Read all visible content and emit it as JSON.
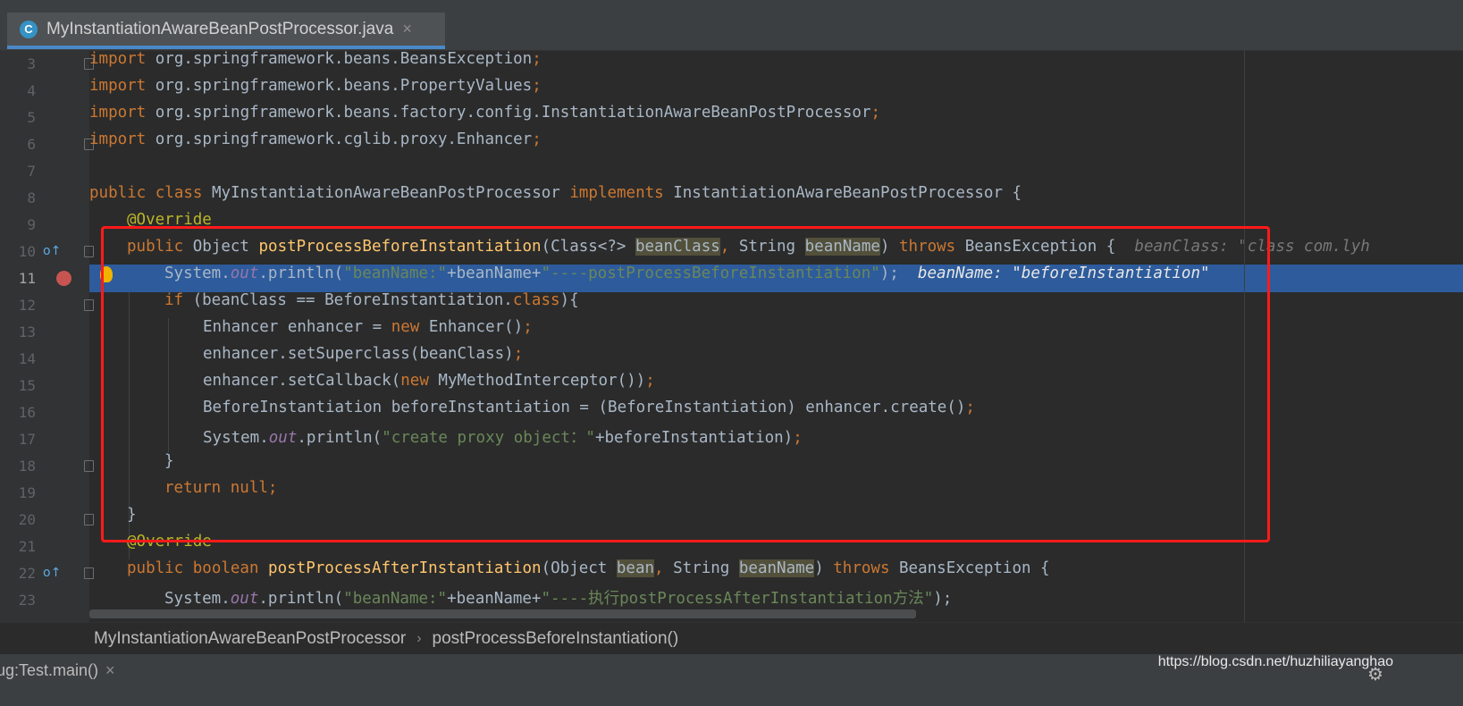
{
  "editor": {
    "tab": {
      "icon": "C",
      "title": "MyInstantiationAwareBeanPostProcessor.java",
      "close": "×"
    },
    "line_numbers": [
      "3",
      "4",
      "5",
      "6",
      "7",
      "8",
      "9",
      "10",
      "11",
      "12",
      "13",
      "14",
      "15",
      "16",
      "17",
      "18",
      "19",
      "20",
      "21",
      "22",
      "23"
    ],
    "current_line": "11",
    "code": {
      "l3": {
        "kw": "import",
        "text": " org.springframework.beans.BeansException",
        "semi": ";"
      },
      "l4": {
        "kw": "import",
        "text": " org.springframework.beans.PropertyValues",
        "semi": ";"
      },
      "l5": {
        "kw": "import",
        "text": " org.springframework.beans.factory.config.InstantiationAwareBeanPostProcessor",
        "semi": ";"
      },
      "l6": {
        "kw": "import",
        "text": " org.springframework.cglib.proxy.Enhancer",
        "semi": ";"
      },
      "l8": {
        "kw1": "public class",
        "cls": " MyInstantiationAwareBeanPostProcessor ",
        "kw2": "implements",
        "iface": " InstantiationAwareBeanPostProcessor {"
      },
      "l9": {
        "ann": "@Override"
      },
      "l10": {
        "kw": "public",
        "t1": " Object ",
        "fn": "postProcessBeforeInstantiation",
        "t2": "(Class<?> ",
        "p1": "beanClass",
        "comma": ",",
        "t3": " String ",
        "p2": "beanName",
        "t4": ") ",
        "kw2": "throws",
        "t5": " BeansException {",
        "hint": "  beanClass: \"class com.lyh"
      },
      "l11": {
        "t1": "System.",
        "st": "out",
        "t2": ".println(",
        "s1": "\"beanName:\"",
        "t3": "+beanName+",
        "s2": "\"----postProcessBeforeInstantiation\"",
        "t4": ");",
        "hint": "  beanName: \"beforeInstantiation\""
      },
      "l12": {
        "kw": "if",
        "t1": " (beanClass == BeforeInstantiation.",
        "kw2": "class",
        "t2": "){"
      },
      "l13": {
        "t1": "Enhancer enhancer = ",
        "kw": "new",
        "t2": " Enhancer()",
        "semi": ";"
      },
      "l14": {
        "t1": "enhancer.setSuperclass(beanClass)",
        "semi": ";"
      },
      "l15": {
        "t1": "enhancer.setCallback(",
        "kw": "new",
        "t2": " MyMethodInterceptor())",
        "semi": ";"
      },
      "l16": {
        "t1": "BeforeInstantiation beforeInstantiation = (BeforeInstantiation) enhancer.create()",
        "semi": ";"
      },
      "l17": {
        "t1": "System.",
        "st": "out",
        "t2": ".println(",
        "s1": "\"create proxy object：\"",
        "t3": "+beforeInstantiation)",
        "semi": ";"
      },
      "l18": {
        "t1": "}"
      },
      "l19": {
        "kw": "return null",
        "semi": ";"
      },
      "l20": {
        "t1": "}"
      },
      "l21": {
        "ann": "@Override"
      },
      "l22": {
        "kw": "public",
        "kwb": " boolean ",
        "fn": "postProcessAfterInstantiation",
        "t2": "(Object ",
        "p1": "bean",
        "comma": ",",
        "t3": " String ",
        "p2": "beanName",
        "t4": ") ",
        "kw2": "throws",
        "t5": " BeansException {"
      },
      "l23": {
        "t1": "System.",
        "st": "out",
        "t2": ".println(",
        "s1": "\"beanName:\"",
        "t3": "+beanName+",
        "s2": "\"----执行postProcessAfterInstantiation方法\"",
        "t4": ");"
      }
    }
  },
  "breadcrumb": {
    "class": "MyInstantiationAwareBeanPostProcessor",
    "sep": "›",
    "method": "postProcessBeforeInstantiation()"
  },
  "bottom": {
    "run_tab": "ug:Test.main()",
    "run_close": "×",
    "watermark": "https://blog.csdn.net/huzhiliayanghao"
  },
  "colors": {
    "highlight": "#2d5b9b",
    "redbox": "#ff1a1a",
    "background": "#2b2b2b"
  }
}
